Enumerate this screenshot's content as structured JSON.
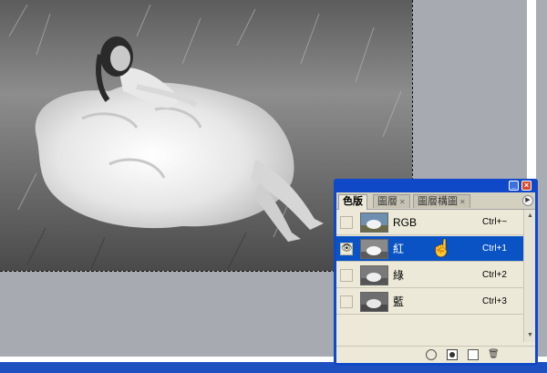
{
  "panel": {
    "tabs": [
      {
        "label": "色版",
        "active": true
      },
      {
        "label": "圖層",
        "active": false
      },
      {
        "label": "圖層構圖",
        "active": false
      }
    ],
    "channels": [
      {
        "name": "RGB",
        "shortcut": "Ctrl+~",
        "visible": false,
        "selected": false
      },
      {
        "name": "紅",
        "shortcut": "Ctrl+1",
        "visible": true,
        "selected": true
      },
      {
        "name": "綠",
        "shortcut": "Ctrl+2",
        "visible": false,
        "selected": false
      },
      {
        "name": "藍",
        "shortcut": "Ctrl+3",
        "visible": false,
        "selected": false
      }
    ],
    "footer_icons": [
      "load-selection-icon",
      "save-selection-icon",
      "new-channel-icon",
      "delete-channel-icon"
    ]
  },
  "window_buttons": {
    "minimize": "_",
    "close": "×"
  },
  "colors": {
    "panel_frame": "#0f49c8",
    "selected_row": "#0a53c4",
    "workspace": "#a7abb1"
  }
}
